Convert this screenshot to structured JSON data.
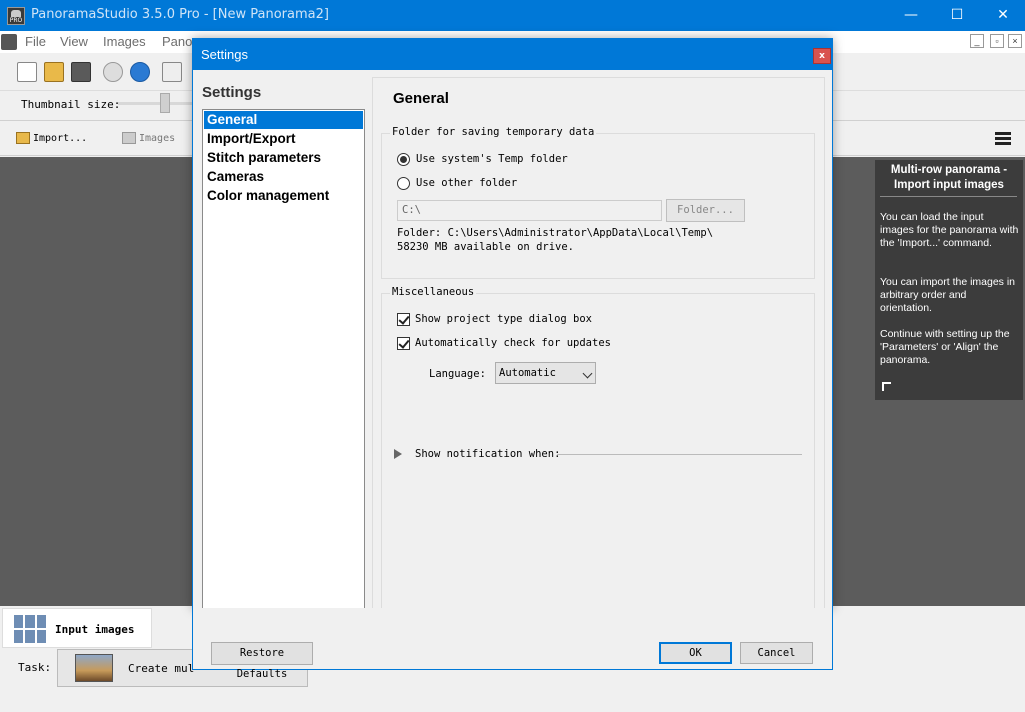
{
  "app": {
    "title": "PanoramaStudio 3.5.0 Pro - [New Panorama2]",
    "window_controls": {
      "minimize": "—",
      "maximize": "☐",
      "close": "✕"
    }
  },
  "menu": {
    "items": [
      "File",
      "View",
      "Images",
      "Pano"
    ]
  },
  "thumbnail": {
    "label": "Thumbnail size:"
  },
  "import_bar": {
    "import_label": "Import...",
    "images_label": "Images"
  },
  "help_panel": {
    "title": "Multi-row panorama - Import input images",
    "paragraphs": [
      "You can load the input images for the panorama with the 'Import...' command.",
      "You can import the images in arbitrary order and orientation.",
      "Continue with setting up the 'Parameters' or 'Align' the panorama."
    ]
  },
  "bottom": {
    "input_tab_label": "Input images",
    "task_label": "Task:",
    "task_button_label": "Create multi"
  },
  "dialog": {
    "title": "Settings",
    "close_label": "x",
    "nav_heading": "Settings",
    "nav_items": [
      "General",
      "Import/Export",
      "Stitch parameters",
      "Cameras",
      "Color management"
    ],
    "selected_nav": "General",
    "content_heading": "General",
    "temp_group": {
      "title": "Folder for saving temporary data",
      "option_system": "Use system's Temp folder",
      "option_other": "Use other folder",
      "selected": "system",
      "folder_value": "C:\\",
      "folder_button": "Folder...",
      "info_line1": "Folder: C:\\Users\\Administrator\\AppData\\Local\\Temp\\",
      "info_line2": "58230 MB available on drive."
    },
    "misc_group": {
      "title": "Miscellaneous",
      "show_project_type": "Show project type dialog box",
      "show_project_type_checked": true,
      "auto_check_updates": "Automatically check for updates",
      "auto_check_updates_checked": true,
      "language_label": "Language:",
      "language_value": "Automatic",
      "notification_label": "Show notification when:"
    },
    "buttons": {
      "restore_defaults": "Restore Defaults",
      "ok": "OK",
      "cancel": "Cancel"
    }
  }
}
